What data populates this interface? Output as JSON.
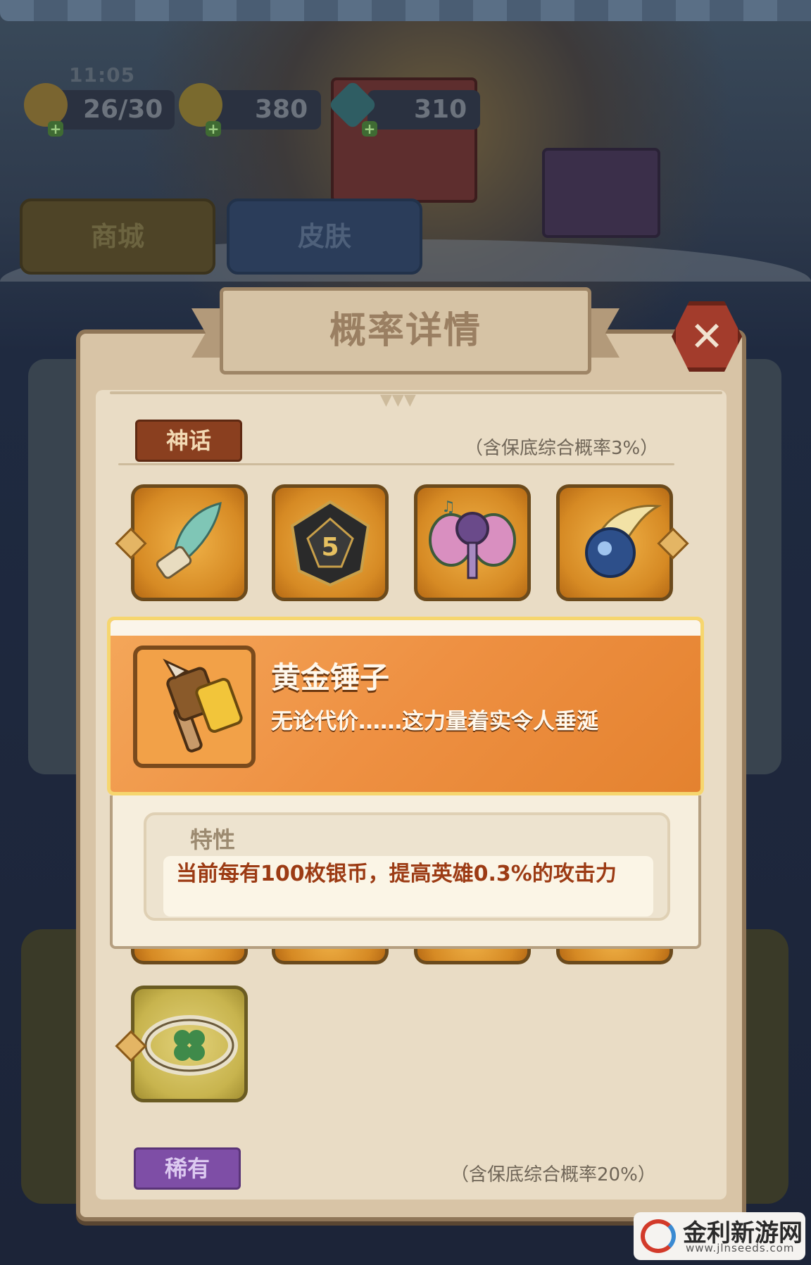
{
  "status_bar": {
    "time": "11:05"
  },
  "resources": [
    {
      "icon": "energy-icon",
      "value": "26/30"
    },
    {
      "icon": "gold-coin-icon",
      "value": "380"
    },
    {
      "icon": "gem-icon",
      "value": "310"
    }
  ],
  "top_tabs": {
    "shop": "商城",
    "skin": "皮肤"
  },
  "dialog": {
    "title": "概率详情",
    "close_icon": "close-icon"
  },
  "tiers": [
    {
      "name": "神话",
      "note": "（含保底综合概率3%）",
      "color": "#8a3f1f"
    },
    {
      "name": "稀有",
      "note": "（含保底综合概率20%）",
      "color": "#7e4ea6"
    }
  ],
  "myth_items": [
    {
      "icon": "feather-quill-icon"
    },
    {
      "icon": "dice-icon",
      "label": "5"
    },
    {
      "icon": "butterfly-microphone-icon"
    },
    {
      "icon": "winged-orb-icon"
    }
  ],
  "extra_items": [
    {
      "icon": "clover-ring-icon"
    }
  ],
  "detail": {
    "icon": "golden-hammer-icon",
    "name": "黄金锤子",
    "description": "无论代价……这力量着实令人垂涎",
    "trait_label": "特性",
    "trait_text": "当前每有100枚银币，提高英雄0.3%的攻击力"
  },
  "watermark": {
    "name": "金利新游网",
    "url": "www.jlnseeds.com"
  },
  "colors": {
    "accent_orange": "#ee9042",
    "close_red": "#a33c2c",
    "trait_text": "#9c3b14"
  }
}
